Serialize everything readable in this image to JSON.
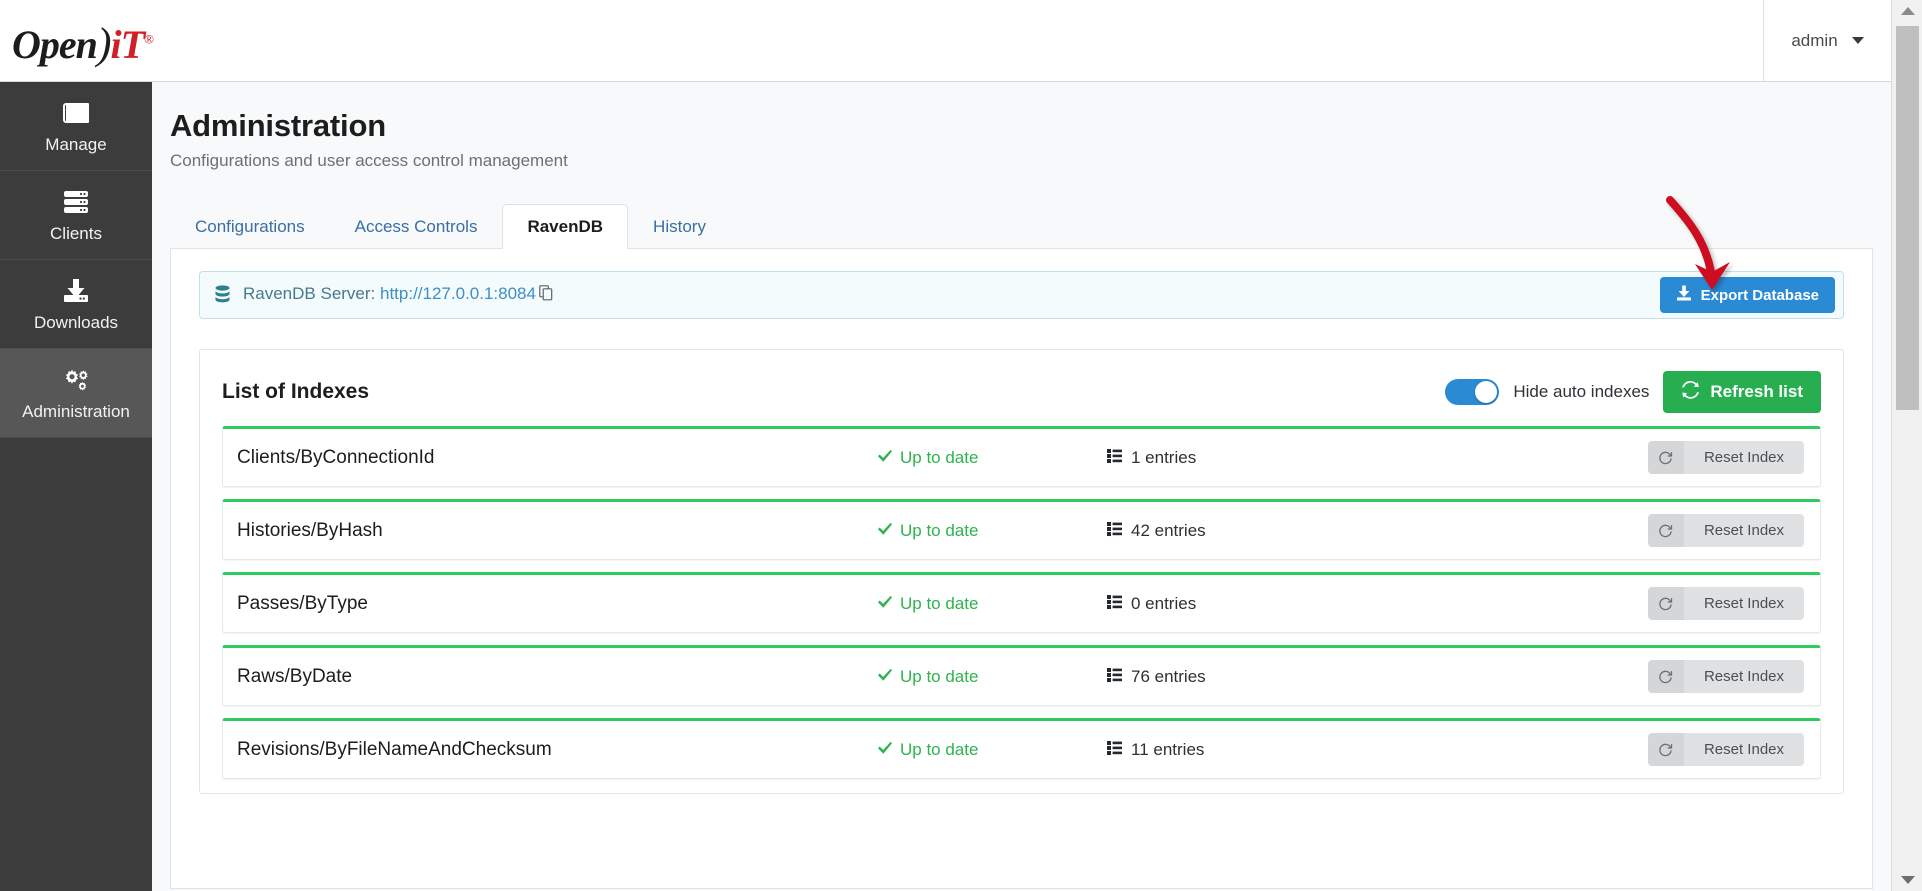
{
  "brand": {
    "logo_open": "Open",
    "logo_paren": ")",
    "logo_it": "iT",
    "logo_registered": "®"
  },
  "header": {
    "user_label": "admin",
    "caret_icon": "chevron-down-icon"
  },
  "sidebar": {
    "items": [
      {
        "label": "Manage",
        "icon": "newspaper-icon",
        "active": false
      },
      {
        "label": "Clients",
        "icon": "server-stack-icon",
        "active": false
      },
      {
        "label": "Downloads",
        "icon": "download-icon",
        "active": false
      },
      {
        "label": "Administration",
        "icon": "gears-icon",
        "active": true
      }
    ]
  },
  "page": {
    "title": "Administration",
    "subtitle": "Configurations and user access control management"
  },
  "tabs": [
    {
      "label": "Configurations",
      "active": false
    },
    {
      "label": "Access Controls",
      "active": false
    },
    {
      "label": "RavenDB",
      "active": true
    },
    {
      "label": "History",
      "active": false
    }
  ],
  "server_bar": {
    "icon": "database-icon",
    "label": "RavenDB Server: ",
    "url": "http://127.0.0.1:8084",
    "copy_icon": "copy-icon",
    "export_button": {
      "label": "Export Database",
      "icon": "download-icon",
      "color": "#2a8ad4"
    }
  },
  "indexes_card": {
    "title": "List of Indexes",
    "toggle": {
      "label": "Hide auto indexes",
      "state": "on",
      "color": "#2a8ad4"
    },
    "refresh_button": {
      "label": "Refresh list",
      "icon": "refresh-icon",
      "color": "#27ae50"
    },
    "reset_button_label": "Reset Index",
    "reset_button_icon": "reset-icon",
    "status_icon": "check-icon",
    "entries_icon": "list-icon",
    "accent_color": "#2ecc5f",
    "rows": [
      {
        "name": "Clients/ByConnectionId",
        "status": "Up to date",
        "entries": "1 entries"
      },
      {
        "name": "Histories/ByHash",
        "status": "Up to date",
        "entries": "42 entries"
      },
      {
        "name": "Passes/ByType",
        "status": "Up to date",
        "entries": "0 entries"
      },
      {
        "name": "Raws/ByDate",
        "status": "Up to date",
        "entries": "76 entries"
      },
      {
        "name": "Revisions/ByFileNameAndChecksum",
        "status": "Up to date",
        "entries": "11 entries"
      }
    ]
  },
  "annotation": {
    "type": "curved-arrow",
    "color": "#cc1122",
    "points_to": "Export Database"
  }
}
